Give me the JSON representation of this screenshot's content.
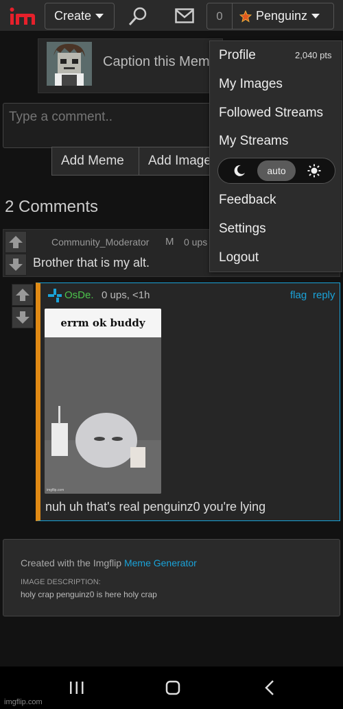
{
  "header": {
    "create_label": "Create",
    "notif_count": "0",
    "username": "Penguinz"
  },
  "caption_bar": {
    "text": "Caption this Meme"
  },
  "comment_box": {
    "placeholder": "Type a comment..",
    "add_meme_label": "Add Meme",
    "add_image_label": "Add Image"
  },
  "comments_heading": "2 Comments",
  "comment1": {
    "user": "Community_Moderator",
    "mod_badge": "M",
    "ups": "0 ups",
    "text": "Brother that is my alt."
  },
  "reply": {
    "user": "OsDe.",
    "meta": "0 ups, <1h",
    "flag_label": "flag",
    "reply_label": "reply",
    "meme_caption": "errm ok buddy",
    "meme_watermark": "imgflip.com",
    "text": "nuh uh that's real penguinz0 you're lying"
  },
  "info": {
    "created_prefix": "Created with the Imgflip ",
    "created_link": "Meme Generator",
    "desc_label": "IMAGE DESCRIPTION:",
    "desc_text": "holy crap penguinz0 is here holy crap"
  },
  "dropdown": {
    "profile_label": "Profile",
    "points": "2,040 pts",
    "my_images": "My Images",
    "followed_streams": "Followed Streams",
    "my_streams": "My Streams",
    "theme_auto": "auto",
    "feedback": "Feedback",
    "settings": "Settings",
    "logout": "Logout"
  },
  "watermark": "imgflip.com",
  "colors": {
    "accent_blue": "#1aa3d9",
    "username_green": "#4cc44c",
    "reply_stripe": "#e08a15",
    "logo_red": "#e6202b"
  }
}
